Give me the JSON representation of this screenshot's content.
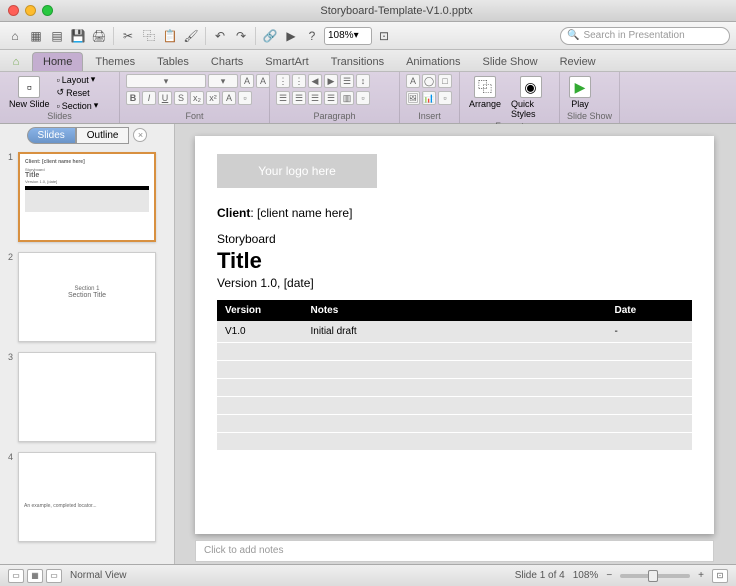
{
  "titlebar": {
    "title": "Storyboard-Template-V1.0.pptx"
  },
  "qat": {
    "zoom": "108%",
    "search_placeholder": "Search in Presentation"
  },
  "tabs": [
    "Home",
    "Themes",
    "Tables",
    "Charts",
    "SmartArt",
    "Transitions",
    "Animations",
    "Slide Show",
    "Review"
  ],
  "ribbon": {
    "slides": {
      "label": "Slides",
      "new_slide": "New Slide",
      "layout": "Layout",
      "reset": "Reset",
      "section": "Section"
    },
    "font": {
      "label": "Font"
    },
    "paragraph": {
      "label": "Paragraph"
    },
    "insert": {
      "label": "Insert"
    },
    "format": {
      "label": "Format",
      "arrange": "Arrange",
      "quick_styles": "Quick Styles"
    },
    "slideshow": {
      "label": "Slide Show",
      "play": "Play"
    }
  },
  "sidebar": {
    "tabs": {
      "slides": "Slides",
      "outline": "Outline"
    },
    "thumbs": [
      {
        "n": "1",
        "preview": "Client: [client name here]\nStoryboard\nTitle\nVersion 1.0, [date]"
      },
      {
        "n": "2",
        "preview": "Section 1\nSection Title"
      },
      {
        "n": "3",
        "preview": ""
      },
      {
        "n": "4",
        "preview": "An example, completed locator..."
      }
    ]
  },
  "slide": {
    "logo_placeholder": "Your logo here",
    "client_label": "Client",
    "client_value": ": [client name here]",
    "storyboard": "Storyboard",
    "title": "Title",
    "version": "Version 1.0, [date]",
    "table": {
      "headers": [
        "Version",
        "Notes",
        "Date"
      ],
      "rows": [
        [
          "V1.0",
          "Initial draft",
          "-"
        ],
        [
          "",
          "",
          ""
        ],
        [
          "",
          "",
          ""
        ],
        [
          "",
          "",
          ""
        ],
        [
          "",
          "",
          ""
        ],
        [
          "",
          "",
          ""
        ],
        [
          "",
          "",
          ""
        ]
      ]
    },
    "notes_placeholder": "Click to add notes"
  },
  "status": {
    "view_label": "Normal View",
    "slide_counter": "Slide 1 of 4",
    "zoom": "108%"
  }
}
